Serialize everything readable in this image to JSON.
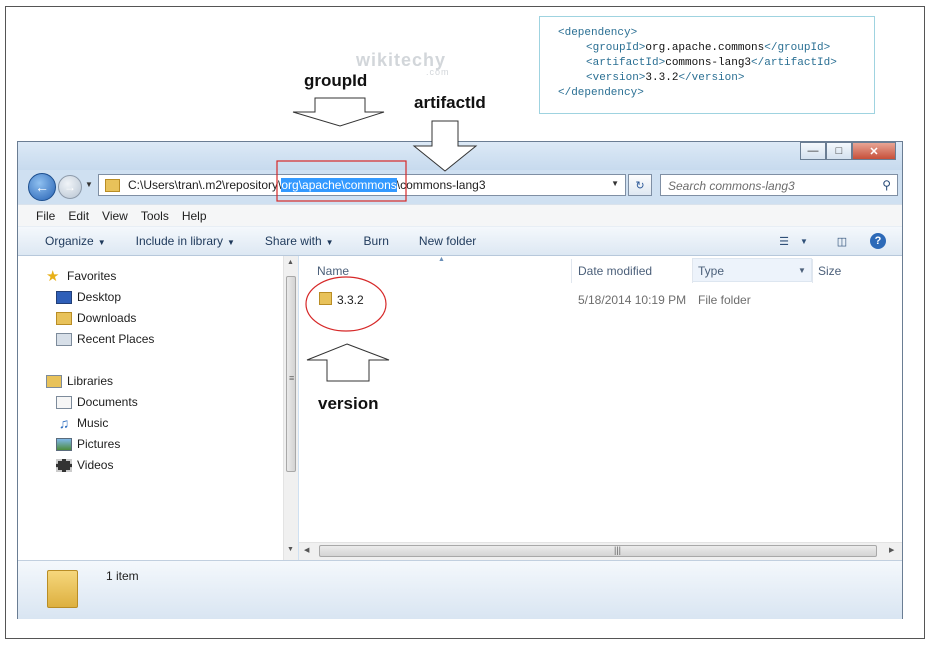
{
  "xml_snippet": {
    "dependency_open": "<dependency>",
    "group_open": "<groupId>",
    "group_value": "org.apache.commons",
    "group_close": "</groupId>",
    "artifact_open": "<artifactId>",
    "artifact_value": "commons-lang3",
    "artifact_close": "</artifactId>",
    "version_open": "<version>",
    "version_value": "3.3.2",
    "version_close": "</version>",
    "dependency_close": "</dependency>"
  },
  "annotations": {
    "group_label": "groupId",
    "artifact_label": "artifactId",
    "version_label": "version"
  },
  "window": {
    "controls": {
      "minimize": "—",
      "maximize": "□",
      "close": "✕"
    },
    "address": {
      "prefix": "C:\\Users\\tran\\.m2\\repository\\",
      "highlighted": "org\\apache\\commons",
      "suffix": "\\commons-lang3"
    },
    "search_placeholder": "Search commons-lang3"
  },
  "menu": [
    "File",
    "Edit",
    "View",
    "Tools",
    "Help"
  ],
  "toolbar": {
    "organize": "Organize",
    "include": "Include in library",
    "share": "Share with",
    "burn": "Burn",
    "new_folder": "New folder"
  },
  "nav": {
    "favorites": "Favorites",
    "desktop": "Desktop",
    "downloads": "Downloads",
    "recent": "Recent Places",
    "libraries": "Libraries",
    "documents": "Documents",
    "music": "Music",
    "pictures": "Pictures",
    "videos": "Videos"
  },
  "columns": {
    "name": "Name",
    "date": "Date modified",
    "type": "Type",
    "size": "Size"
  },
  "files": [
    {
      "name": "3.3.2",
      "date": "5/18/2014 10:19 PM",
      "type": "File folder",
      "size": ""
    }
  ],
  "status": {
    "count": "1 item"
  },
  "watermark": {
    "brand": "wikitechy",
    "domain": ".com"
  },
  "colors": {
    "highlight": "#3399ff",
    "red_marker": "#d62828",
    "xml_tag": "#2a6f93"
  },
  "icons": {
    "back": "back-arrow-icon",
    "forward": "forward-arrow-icon",
    "refresh": "refresh-icon",
    "search": "search-icon",
    "views": "view-options-icon",
    "preview": "preview-pane-icon",
    "help": "help-icon",
    "folder": "folder-icon"
  }
}
